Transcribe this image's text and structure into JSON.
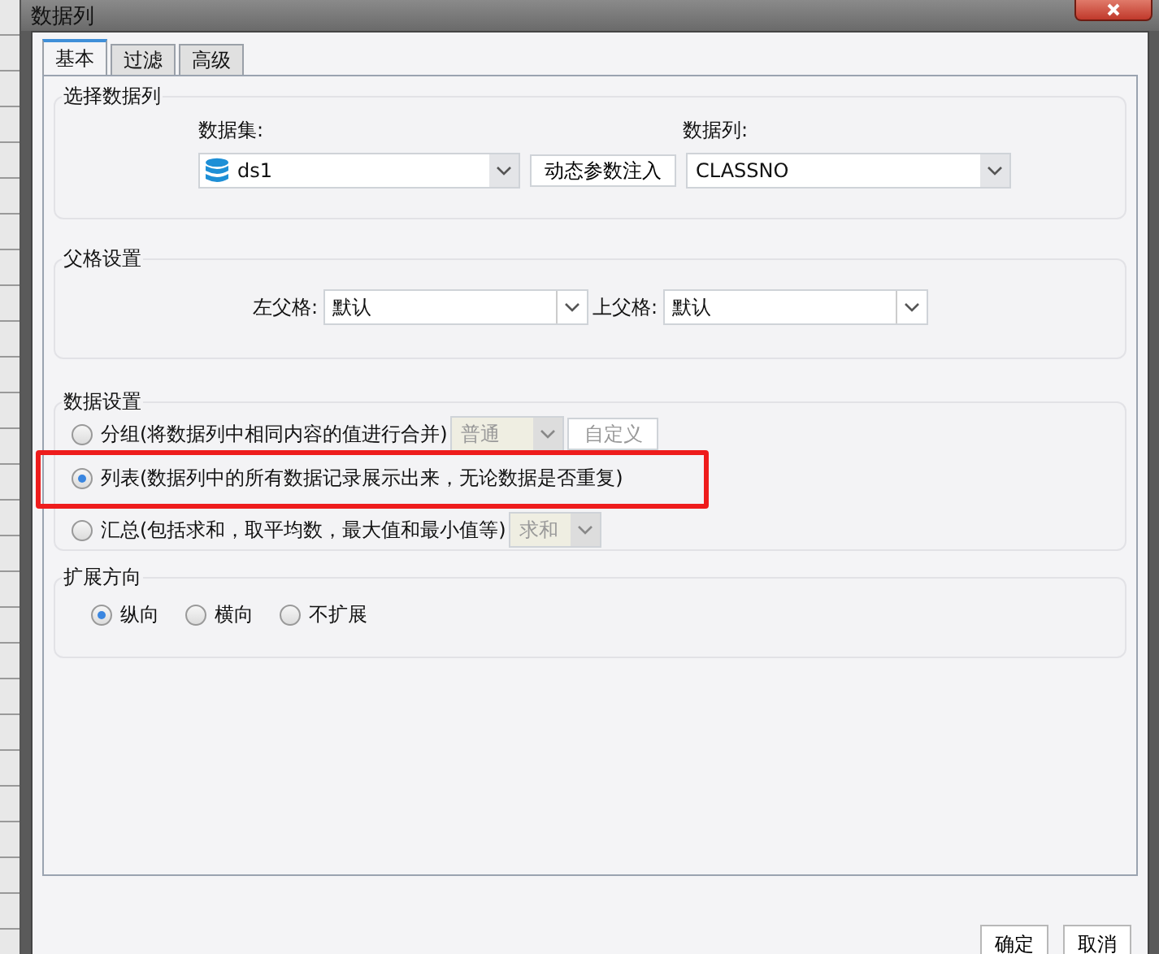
{
  "window": {
    "title": "数据列"
  },
  "tabs": [
    {
      "label": "基本",
      "selected": true
    },
    {
      "label": "过滤",
      "selected": false
    },
    {
      "label": "高级",
      "selected": false
    }
  ],
  "select_column": {
    "title": "选择数据列",
    "dataset_label": "数据集:",
    "dataset_value": "ds1",
    "dynamic_button": "动态参数注入",
    "column_label": "数据列:",
    "column_value": "CLASSNO"
  },
  "parent": {
    "title": "父格设置",
    "left_label": "左父格:",
    "left_value": "默认",
    "top_label": "上父格:",
    "top_value": "默认"
  },
  "data_settings": {
    "title": "数据设置",
    "options": [
      {
        "kind": "group",
        "label": "分组(将数据列中相同内容的值进行合并)",
        "selected": false,
        "highlighted": false,
        "dropdown": "普通",
        "dropdown_disabled": true,
        "button": "自定义",
        "button_disabled": true
      },
      {
        "kind": "plain",
        "label": "列表(数据列中的所有数据记录展示出来，无论数据是否重复)",
        "selected": true,
        "highlighted": true
      },
      {
        "kind": "summary",
        "label": "汇总(包括求和，取平均数，最大值和最小值等)",
        "selected": false,
        "highlighted": false,
        "dropdown": "求和",
        "dropdown_disabled": true
      }
    ]
  },
  "expand": {
    "title": "扩展方向",
    "options": [
      {
        "label": "纵向",
        "selected": true
      },
      {
        "label": "横向",
        "selected": false
      },
      {
        "label": "不扩展",
        "selected": false
      }
    ]
  },
  "buttons": [
    "确定",
    "取消"
  ]
}
